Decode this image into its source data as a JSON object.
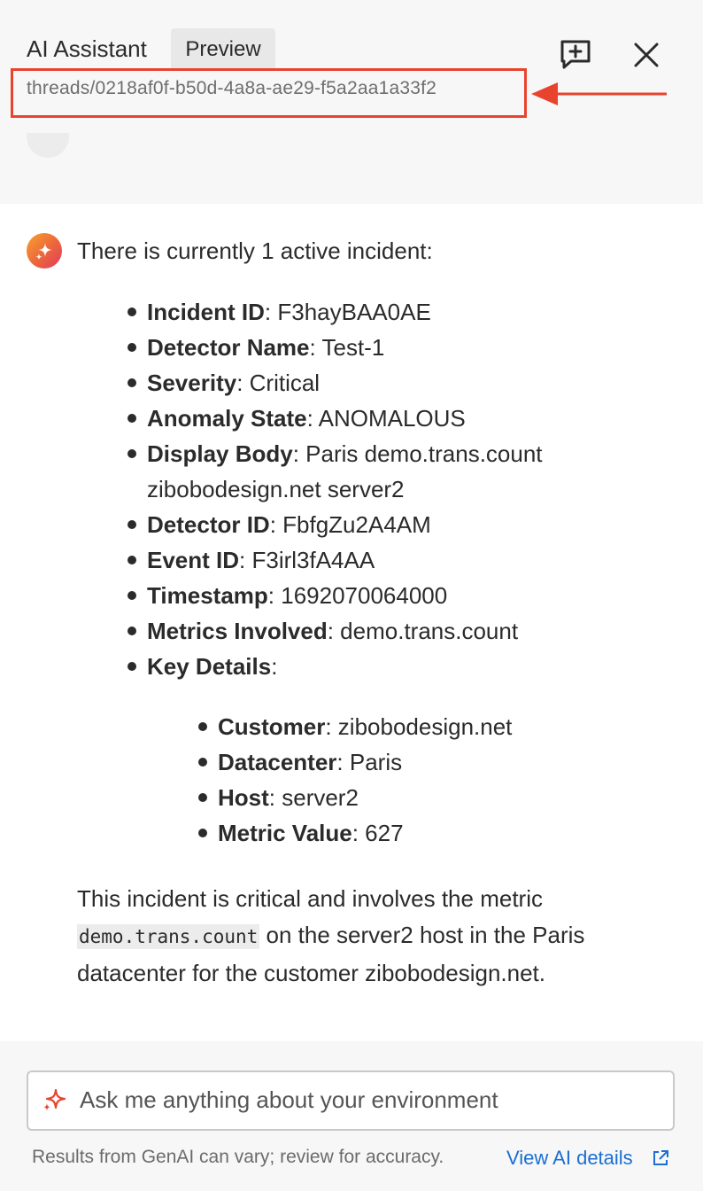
{
  "header": {
    "title": "AI Assistant",
    "badge": "Preview",
    "thread_path": "threads/0218af0f-b50d-4a8a-ae29-f5a2aa1a33f2",
    "new_chat_icon": "message-plus-icon",
    "close_icon": "close-icon",
    "highlight_color": "#e8432e"
  },
  "message": {
    "intro": "There is currently 1 active incident:",
    "fields": [
      {
        "key": "Incident ID",
        "value": ": F3hayBAA0AE"
      },
      {
        "key": "Detector Name",
        "value": ": Test-1"
      },
      {
        "key": "Severity",
        "value": ": Critical"
      },
      {
        "key": "Anomaly State",
        "value": ": ANOMALOUS"
      },
      {
        "key": "Display Body",
        "value": ": Paris demo.trans.count zibobodesign.net server2"
      },
      {
        "key": "Detector ID",
        "value": ": FbfgZu2A4AM"
      },
      {
        "key": "Event ID",
        "value": ": F3irl3fA4AA"
      },
      {
        "key": "Timestamp",
        "value": ": 1692070064000"
      },
      {
        "key": "Metrics Involved",
        "value": ": demo.trans.count"
      },
      {
        "key": "Key Details",
        "value": ":"
      }
    ],
    "key_details": [
      {
        "key": "Customer",
        "value": ": zibobodesign.net"
      },
      {
        "key": "Datacenter",
        "value": ": Paris"
      },
      {
        "key": "Host",
        "value": ": server2"
      },
      {
        "key": "Metric Value",
        "value": ": 627"
      }
    ],
    "summary_pre": "This incident is critical and involves the metric ",
    "summary_code": "demo.trans.count",
    "summary_post": " on the server2 host in the Paris datacenter for the customer zibobodesign.net."
  },
  "footer": {
    "input_placeholder": "Ask me anything about your environment",
    "disclaimer": "Results from GenAI can vary; review for accuracy.",
    "link_label": "View AI details",
    "link_color": "#1b6fd1"
  }
}
